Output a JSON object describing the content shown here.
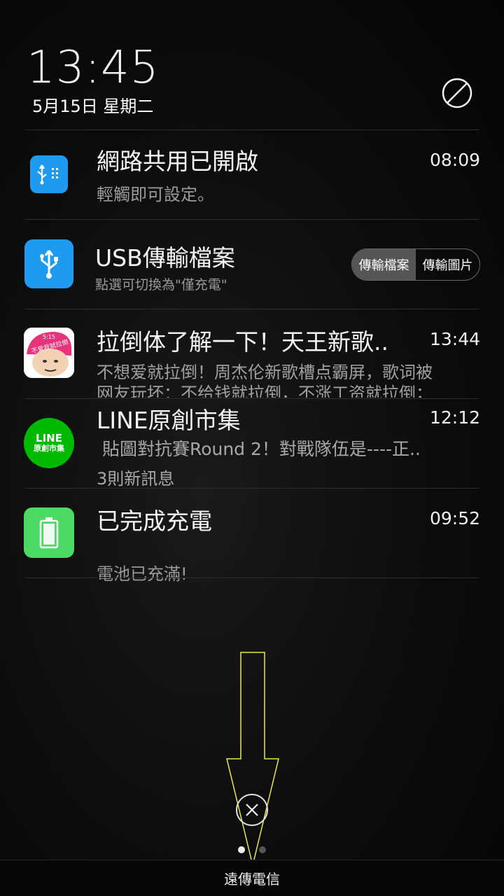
{
  "status": {
    "time": "13:45",
    "date": "5月15日 星期二"
  },
  "notifications": [
    {
      "icon": "usb-tether-icon",
      "title": "網路共用已開啟",
      "time": "08:09",
      "text": "輕觸即可設定。"
    },
    {
      "icon": "usb-icon",
      "title": "USB傳輸檔案",
      "text": "點選可切換為\"僅充電\"",
      "toggle": [
        "傳輸檔案",
        "傳輸圖片"
      ]
    },
    {
      "icon": "meme-app-icon",
      "icon_text": [
        "5:15",
        "不爱我就拉倒"
      ],
      "title": "拉倒体了解一下！天王新歌..",
      "time": "13:44",
      "text_lines": [
        "不想爱就拉倒！周杰伦新歌槽点霸屏，歌词被",
        "网友玩坏：不给钱就拉倒，不涨工资就拉倒；"
      ]
    },
    {
      "icon": "line-creators-icon",
      "icon_text": [
        "LINE",
        "原創市集"
      ],
      "title": "LINE原創市集",
      "time": "12:12",
      "text": " 貼圖對抗賽Round 2！對戰隊伍是----正..",
      "subtext": "3則新訊息"
    },
    {
      "icon": "battery-full-icon",
      "title": "已完成充電",
      "time": "09:52",
      "text": "電池已充滿!"
    }
  ],
  "footer": {
    "carrier": "遠傳電信"
  },
  "colors": {
    "usb_blue": "#1e9bf0",
    "line_green": "#00b900",
    "battery_green": "#4cd964",
    "meme_pink": "#e8337a"
  }
}
